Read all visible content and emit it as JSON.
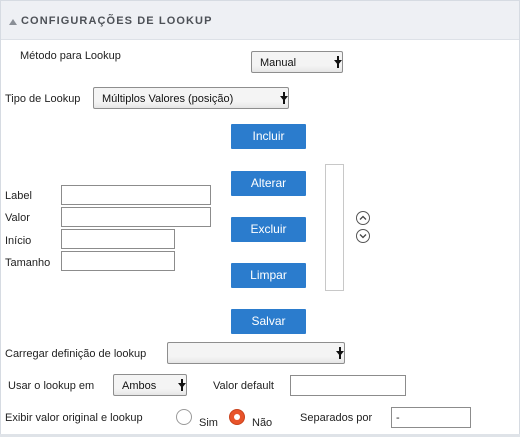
{
  "header": {
    "title": "CONFIGURAÇÕES DE LOOKUP"
  },
  "method": {
    "label": "Método para Lookup",
    "selected": "Manual"
  },
  "lookup_type": {
    "label": "Tipo de Lookup",
    "selected": "Múltiplos Valores (posição)"
  },
  "buttons": {
    "include": "Incluir",
    "change": "Alterar",
    "delete": "Excluir",
    "clear": "Limpar",
    "save": "Salvar"
  },
  "fields": {
    "label": {
      "label": "Label",
      "value": ""
    },
    "value": {
      "label": "Valor",
      "value": ""
    },
    "start": {
      "label": "Início",
      "value": ""
    },
    "size": {
      "label": "Tamanho",
      "value": ""
    }
  },
  "load_definition": {
    "label": "Carregar definição de lookup",
    "selected": ""
  },
  "use_lookup": {
    "label": "Usar o lookup em",
    "selected": "Ambos"
  },
  "default_value": {
    "label": "Valor default",
    "value": ""
  },
  "show_original": {
    "label": "Exibir valor original e lookup",
    "option_yes": "Sim",
    "option_no": "Não",
    "selected": "Não"
  },
  "separator": {
    "label": "Separados por",
    "value": "-"
  },
  "icons": {
    "header": "collapse-triangle-icon",
    "move_up": "chevron-up-circle-icon",
    "move_down": "chevron-down-circle-icon"
  },
  "colors": {
    "button": "#2b7ccd",
    "header_bg": "#eef0f4",
    "radio_selected": "#e8532a"
  }
}
